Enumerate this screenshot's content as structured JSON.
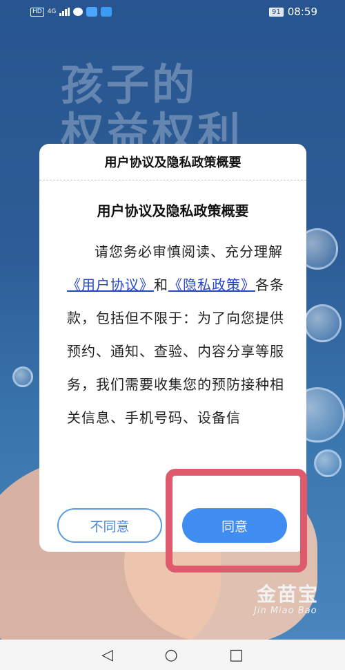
{
  "status_bar": {
    "network_badge": "HD",
    "network_type": "4G",
    "battery": "91",
    "time": "08:59"
  },
  "background": {
    "headline": "孩子的",
    "headline2": "权益权利",
    "brand": "金苗宝",
    "brand_sub": "Jin Miao Bao"
  },
  "dialog": {
    "header_title": "用户协议及隐私政策概要",
    "subtitle": "用户协议及隐私政策概要",
    "text_before_link1": "请您务必审慎阅读、充分理解",
    "link1": "《用户协议》",
    "text_between": "和",
    "link2": "《隐私政策》",
    "text_after_links": "各条款，包括但不限于：为了向您提供预约、通知、查验、内容分享等服务，我们需要收集您的预防接种相关信息、手机号码、设备信",
    "disagree_label": "不同意",
    "agree_label": "同意"
  },
  "navbar": {
    "back_icon": "◁",
    "home_icon": "○",
    "recent_icon": "□"
  }
}
